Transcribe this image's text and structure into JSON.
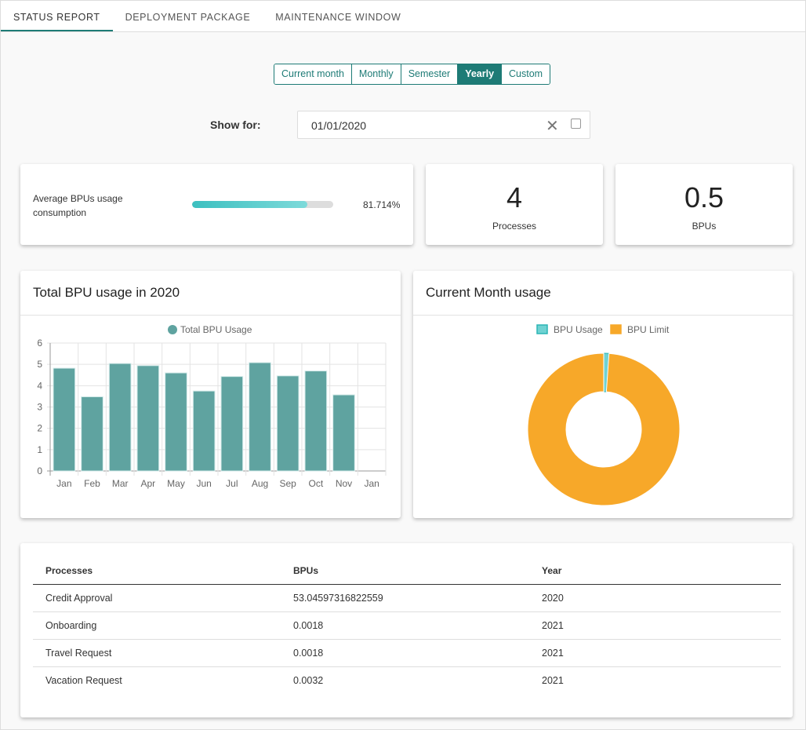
{
  "tabs": [
    "STATUS REPORT",
    "DEPLOYMENT PACKAGE",
    "MAINTENANCE WINDOW"
  ],
  "active_tab": 0,
  "periods": [
    "Current month",
    "Monthly",
    "Semester",
    "Yearly",
    "Custom"
  ],
  "selected_period": "Yearly",
  "show_for": {
    "label": "Show for:",
    "value": "01/01/2020"
  },
  "avg_usage": {
    "label": "Average BPUs usage consumption",
    "value_text": "81.714%",
    "percent": 81.714
  },
  "kpis": [
    {
      "value": "4",
      "label": "Processes"
    },
    {
      "value": "0.5",
      "label": "BPUs"
    }
  ],
  "colors": {
    "accent": "#1e7b76",
    "bar": "#5fa3a0",
    "usage": "#6fd2d2",
    "limit": "#f7a829"
  },
  "chart_data": [
    {
      "type": "bar",
      "title": "Total BPU usage in 2020",
      "categories": [
        "Jan",
        "Feb",
        "Mar",
        "Apr",
        "May",
        "Jun",
        "Jul",
        "Aug",
        "Sep",
        "Oct",
        "Nov",
        "Jan"
      ],
      "series": [
        {
          "name": "Total BPU Usage",
          "values": [
            4.82,
            3.48,
            5.04,
            4.94,
            4.6,
            3.75,
            4.43,
            5.08,
            4.46,
            4.69,
            3.57,
            0
          ]
        }
      ],
      "ylim": [
        0,
        6
      ],
      "yticks": [
        "0",
        "1",
        "2",
        "3",
        "4",
        "5",
        "6"
      ],
      "grid": true,
      "legend": "top"
    },
    {
      "type": "pie",
      "title": "Current Month usage",
      "labels": [
        "BPU Usage",
        "BPU Limit"
      ],
      "values": [
        0.5,
        44.5
      ],
      "donut": true,
      "legend": "top"
    }
  ],
  "table": {
    "headers": [
      "Processes",
      "BPUs",
      "Year"
    ],
    "rows": [
      [
        "Credit Approval",
        "53.04597316822559",
        "2020"
      ],
      [
        "Onboarding",
        "0.0018",
        "2021"
      ],
      [
        "Travel Request",
        "0.0018",
        "2021"
      ],
      [
        "Vacation Request",
        "0.0032",
        "2021"
      ]
    ]
  }
}
